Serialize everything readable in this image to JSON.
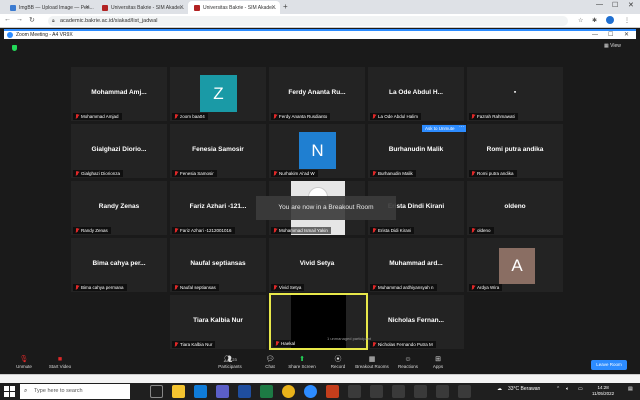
{
  "browser": {
    "tabs": [
      {
        "label": "ImgBB — Upload Image — Pen..."
      },
      {
        "label": "Universitas Bakrie - SIM Akade..."
      },
      {
        "label": "Universitas Bakrie - SIM Akade..."
      }
    ],
    "new_tab": "+",
    "url": "academic.bakrie.ac.id/siakad/list_jadwal"
  },
  "zoom": {
    "window_title": "Zoom Meeting - A4 VR9X",
    "view_label": "View",
    "breakout_message": "You are now in a Breakout Room",
    "unmanaged_label": "1 unmanaged participant",
    "ask_to_unmute": "Ask to Unmute",
    "ask_more": "···"
  },
  "participants": [
    {
      "name": "Mohammad  Amj...",
      "label": "Mohammad Amjad"
    },
    {
      "name": "",
      "label": "zoom baa04",
      "avatar": "Z",
      "avatar_color": "#1a9aa6"
    },
    {
      "name": "Ferdy Ananta Ru...",
      "label": "Ferdy Ananta Rusdianto"
    },
    {
      "name": "La Ode Abdul H...",
      "label": "La Ode Abdul Halim"
    },
    {
      "name": "▪",
      "label": "Fazrah Rahmawati"
    },
    {
      "name": "Gialghazi  Diorio...",
      "label": "Gialghazi Diorionza"
    },
    {
      "name": "Fenesia Samosir",
      "label": "Fenesia Samosir"
    },
    {
      "name": "",
      "label": "Nurhakim Ai'ad W",
      "avatar": "N",
      "avatar_color": "#1f7fd1"
    },
    {
      "name": "Burhanudin Malik",
      "label": "Burhanudin Malik"
    },
    {
      "name": "Romi putra andika",
      "label": "Romi putra andika"
    },
    {
      "name": "Randy Zenas",
      "label": "Randy Zenas"
    },
    {
      "name": "Fariz Azhari -121...",
      "label": "Fariz Azhari -1212001016"
    },
    {
      "name": "",
      "label": "Mohammad Ismail Yakin"
    },
    {
      "name": "Erista Dindi Kirani",
      "label": "Erista Didi Kirani"
    },
    {
      "name": "oldeno",
      "label": "oldeno"
    },
    {
      "name": "Bima cahya per...",
      "label": "Bima cahya permana"
    },
    {
      "name": "Naufal septiansas",
      "label": "Naufal septiansas"
    },
    {
      "name": "Vivid Setya",
      "label": "Vivid Setya"
    },
    {
      "name": "Muhammad  ard...",
      "label": "Muhammad ardhiyansyah n"
    },
    {
      "name": "",
      "label": "Ardya Wira",
      "avatar": "A",
      "avatar_color": "#8a6e63"
    },
    {
      "name": "Tiara Kalbia Nur",
      "label": "Tiara Kalbia Nur"
    },
    {
      "name": "",
      "label": "Haekal"
    },
    {
      "name": "Nicholas  Fernan...",
      "label": "Nicholas Fernando Putra M"
    }
  ],
  "toolbar": {
    "unmute": "Unmute",
    "start_video": "Start Video",
    "participants": "Participants",
    "participants_count": "23",
    "chat": "Chat",
    "share_screen": "Share Screen",
    "record": "Record",
    "breakout_rooms": "Breakout Rooms",
    "reactions": "Reactions",
    "apps": "Apps",
    "leave_room": "Leave Room"
  },
  "taskbar": {
    "search_placeholder": "Type here to search",
    "weather": "33°C  Berawan",
    "time": "14:28",
    "date": "11/05/2022"
  },
  "colors": {
    "zoom_blue": "#2d8cff",
    "active_speaker": "#e8e84a",
    "mic_muted": "#e02828"
  }
}
